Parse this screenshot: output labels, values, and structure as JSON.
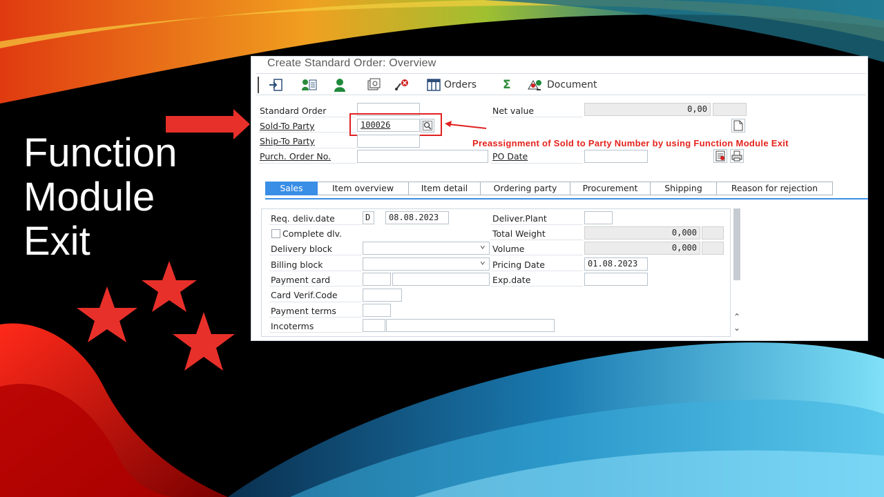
{
  "slide": {
    "title_lines": [
      "Function",
      "Module",
      "Exit"
    ],
    "annotation": "Preassignment of Sold to Party Number by using Function Module Exit"
  },
  "colors": {
    "accent_red": "#e02020",
    "tab_active": "#3a8ee6"
  },
  "window": {
    "title": "Create Standard Order: Overview"
  },
  "toolbar": {
    "orders_label": "Orders",
    "document_label": "Document",
    "icons": [
      "enter-icon",
      "display-doc-flow-icon",
      "business-partner-icon",
      "status-overview-icon",
      "deletion-icon",
      "orders-table-icon",
      "sum-icon",
      "document-icon"
    ]
  },
  "header": {
    "standard_order_label": "Standard Order",
    "standard_order_value": "",
    "sold_to_label": "Sold-To Party",
    "sold_to_value": "100026",
    "ship_to_label": "Ship-To Party",
    "ship_to_value": "",
    "purch_order_label": "Purch. Order No.",
    "purch_order_value": "",
    "net_value_label": "Net value",
    "net_value": "0,00",
    "currency": "",
    "po_date_label": "PO Date",
    "po_date_value": ""
  },
  "tabs": [
    "Sales",
    "Item overview",
    "Item detail",
    "Ordering party",
    "Procurement",
    "Shipping",
    "Reason for rejection"
  ],
  "sales": {
    "req_deliv_label": "Req. deliv.date",
    "req_deliv_format": "D",
    "req_deliv_date": "08.08.2023",
    "complete_dlv_label": "Complete dlv.",
    "delivery_block_label": "Delivery block",
    "delivery_block_value": "",
    "billing_block_label": "Billing block",
    "billing_block_value": "",
    "payment_card_label": "Payment card",
    "card_verif_label": "Card Verif.Code",
    "payment_terms_label": "Payment terms",
    "incoterms_label": "Incoterms",
    "deliver_plant_label": "Deliver.Plant",
    "deliver_plant_value": "",
    "total_weight_label": "Total Weight",
    "total_weight": "0,000",
    "volume_label": "Volume",
    "volume": "0,000",
    "pricing_date_label": "Pricing Date",
    "pricing_date": "01.08.2023",
    "exp_date_label": "Exp.date"
  }
}
